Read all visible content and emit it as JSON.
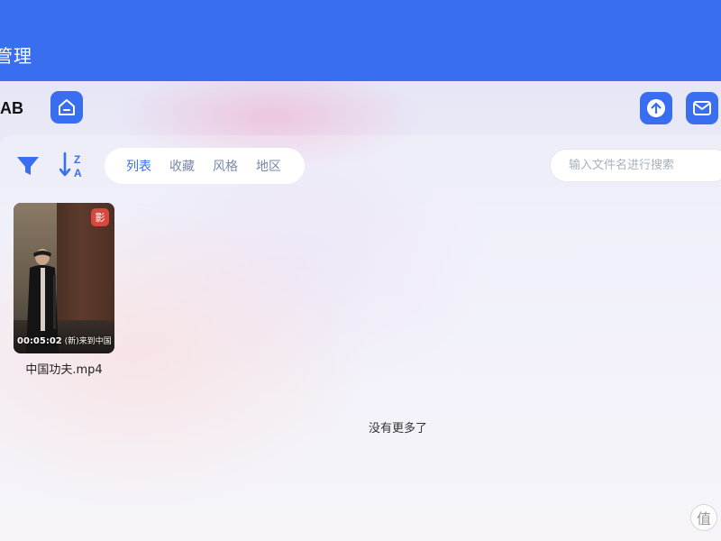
{
  "header": {
    "title": "管理",
    "bg_color": "#3a6ef0"
  },
  "toolbar": {
    "drive_name": "AB",
    "home_icon": "home-icon",
    "upload_icon": "upload-arrow-icon",
    "mail_icon": "mail-icon"
  },
  "filters": {
    "filter_icon": "filter-funnel-icon",
    "sort_icon": "sort-z-a-icon",
    "tabs": [
      {
        "label": "列表",
        "active": true
      },
      {
        "label": "收藏",
        "active": false
      },
      {
        "label": "风格",
        "active": false
      },
      {
        "label": "地区",
        "active": false
      }
    ],
    "accent_color": "#3a6ef0"
  },
  "search": {
    "placeholder": "输入文件名进行搜索"
  },
  "files": [
    {
      "name": "中国功夫.mp4",
      "badge": "影",
      "badge_color": "#d9473f",
      "duration": "00:05:02",
      "caption": "(新)来到中国"
    }
  ],
  "footer": {
    "no_more": "没有更多了",
    "watermark": "值"
  }
}
